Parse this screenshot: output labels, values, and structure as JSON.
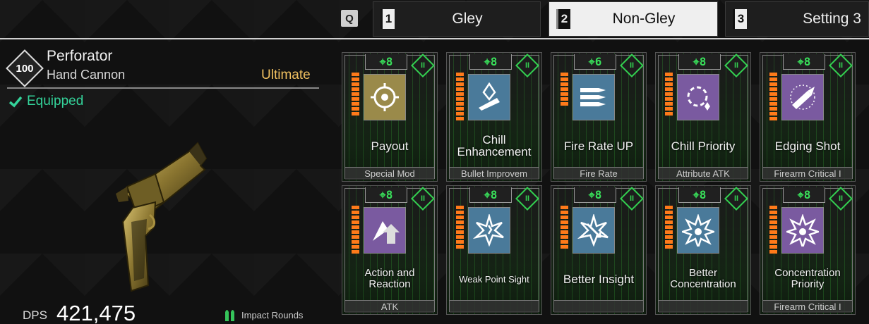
{
  "hotkey": "Q",
  "tabs": [
    {
      "number": "1",
      "label": "Gley",
      "active": false
    },
    {
      "number": "2",
      "label": "Non-Gley",
      "active": true
    },
    {
      "number": "3",
      "label": "Setting 3",
      "active": false
    }
  ],
  "weapon": {
    "level": "100",
    "name": "Perforator",
    "type": "Hand Cannon",
    "rarity": "Ultimate",
    "status": "Equipped",
    "dps_label": "DPS",
    "dps_value": "421,475",
    "ammo": "Impact Rounds"
  },
  "colors": {
    "rarity": "#f0c060",
    "equipped": "#34d39a",
    "capacity": "#39e05a",
    "bars": "#ff7a1a"
  },
  "modules": [
    {
      "capacity": "8",
      "name": "Payout",
      "type": "Special Mod",
      "icon": "brain-gear-icon",
      "bg": "#9a8a4a",
      "fill": 9
    },
    {
      "capacity": "8",
      "name": "Chill Enhancement",
      "type": "Bullet Improvem",
      "icon": "ice-bullet-icon",
      "bg": "#4a7a9a",
      "fill": 10
    },
    {
      "capacity": "6",
      "name": "Fire Rate UP",
      "type": "Fire Rate",
      "icon": "bullets-icon",
      "bg": "#4a7a9a",
      "fill": 7
    },
    {
      "capacity": "8",
      "name": "Chill Priority",
      "type": "Attribute ATK",
      "icon": "chill-burst-icon",
      "bg": "#7a5aa0",
      "fill": 9
    },
    {
      "capacity": "8",
      "name": "Edging Shot",
      "type": "Firearm Critical I",
      "icon": "edging-bullet-icon",
      "bg": "#7a5aa0",
      "fill": 10
    },
    {
      "capacity": "8",
      "name": "Action and Reaction",
      "type": "ATK",
      "icon": "shatter-arrow-icon",
      "bg": "#7a5aa0",
      "fill": 10
    },
    {
      "capacity": "8",
      "name": "Weak Point Sight",
      "type": "",
      "icon": "weak-point-icon",
      "bg": "#4a7a9a",
      "fill": 9
    },
    {
      "capacity": "8",
      "name": "Better Insight",
      "type": "",
      "icon": "insight-burst-icon",
      "bg": "#4a7a9a",
      "fill": 9
    },
    {
      "capacity": "8",
      "name": "Better Concentration",
      "type": "",
      "icon": "star-burst-icon",
      "bg": "#4a7a9a",
      "fill": 9
    },
    {
      "capacity": "8",
      "name": "Concentration Priority",
      "type": "Firearm Critical I",
      "icon": "star-burst-icon",
      "bg": "#7a5aa0",
      "fill": 10
    }
  ]
}
